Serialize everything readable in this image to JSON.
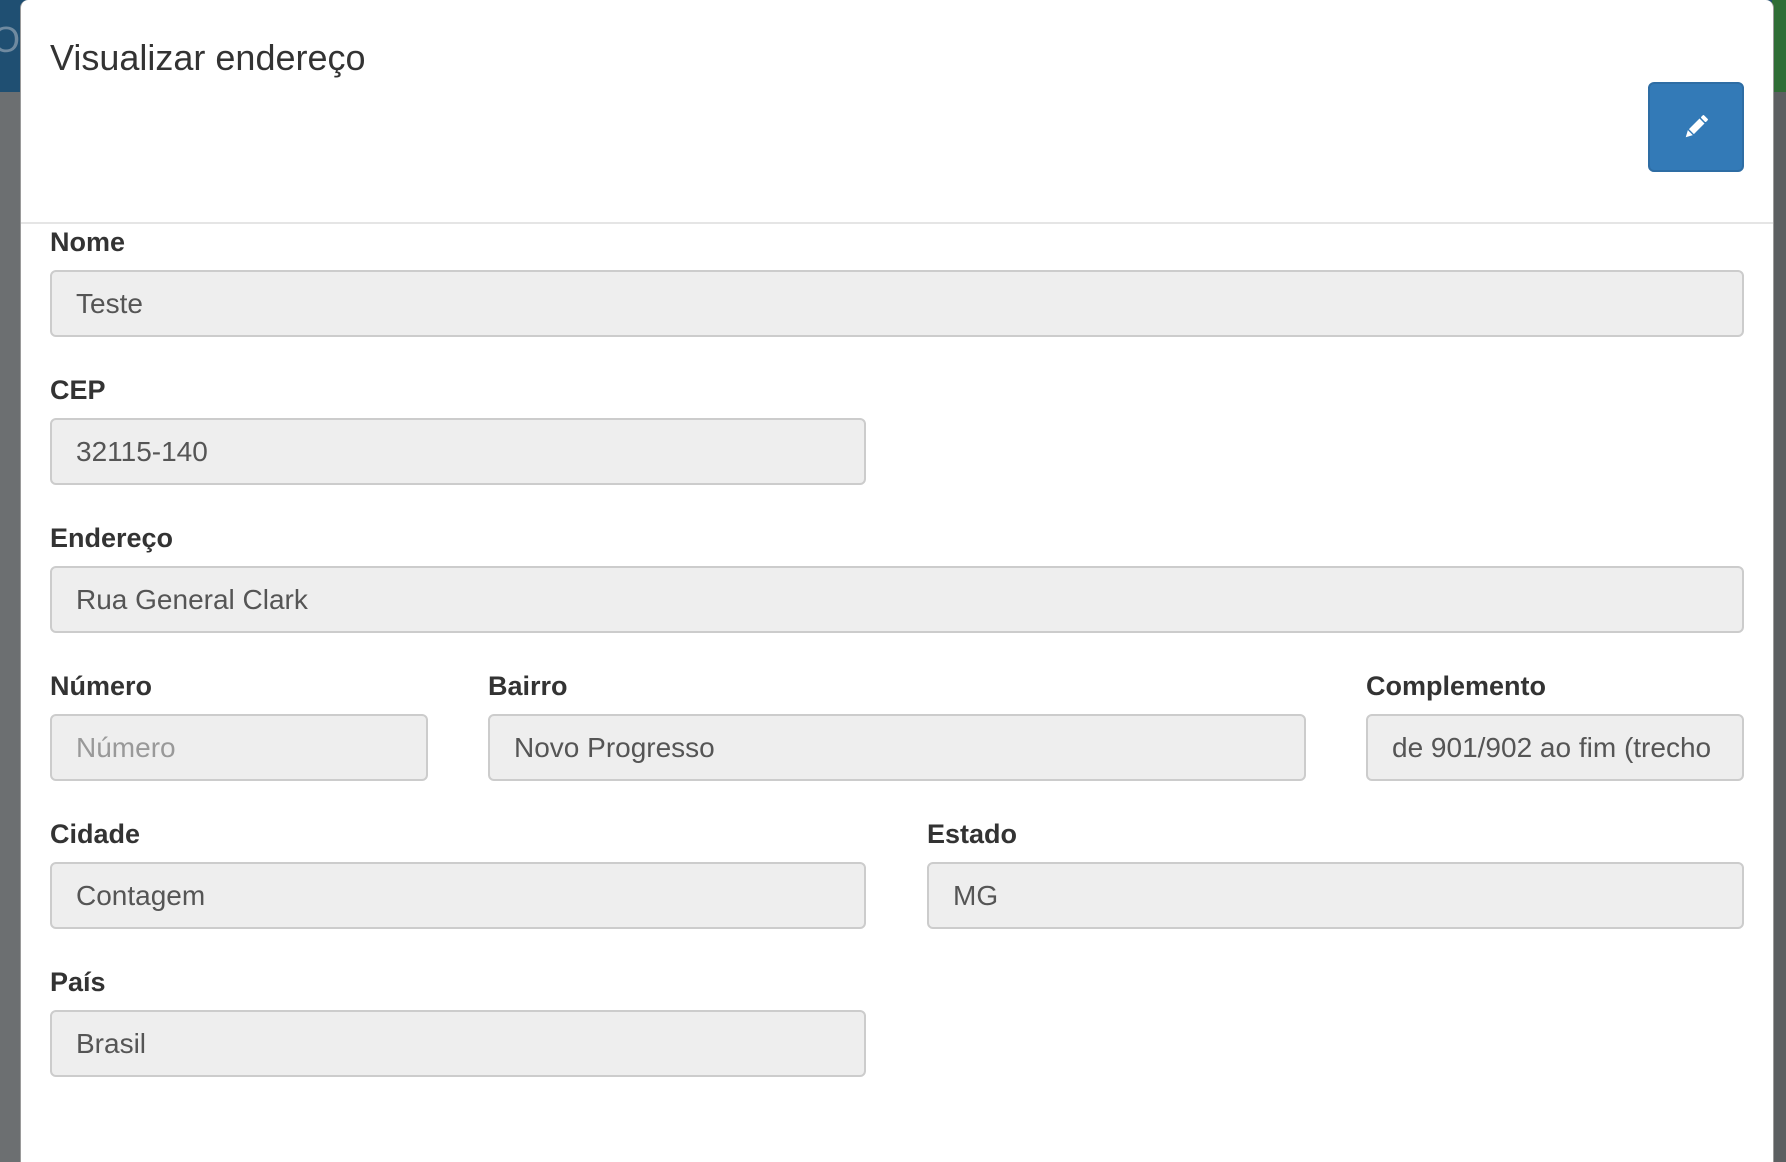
{
  "background": {
    "header_fragment": "Or"
  },
  "modal": {
    "title": "Visualizar endereço",
    "edit_button_icon": "pencil-icon",
    "accent_color": "#337ab7",
    "fields": {
      "nome": {
        "label": "Nome",
        "value": "Teste",
        "placeholder": ""
      },
      "cep": {
        "label": "CEP",
        "value": "32115-140",
        "placeholder": ""
      },
      "endereco": {
        "label": "Endereço",
        "value": "Rua General Clark",
        "placeholder": ""
      },
      "numero": {
        "label": "Número",
        "value": "",
        "placeholder": "Número"
      },
      "bairro": {
        "label": "Bairro",
        "value": "Novo Progresso",
        "placeholder": ""
      },
      "complemento": {
        "label": "Complemento",
        "value": "de 901/902 ao fim (trecho",
        "placeholder": ""
      },
      "cidade": {
        "label": "Cidade",
        "value": "Contagem",
        "placeholder": ""
      },
      "estado": {
        "label": "Estado",
        "value": "MG",
        "placeholder": ""
      },
      "pais": {
        "label": "País",
        "value": "Brasil",
        "placeholder": ""
      }
    }
  }
}
